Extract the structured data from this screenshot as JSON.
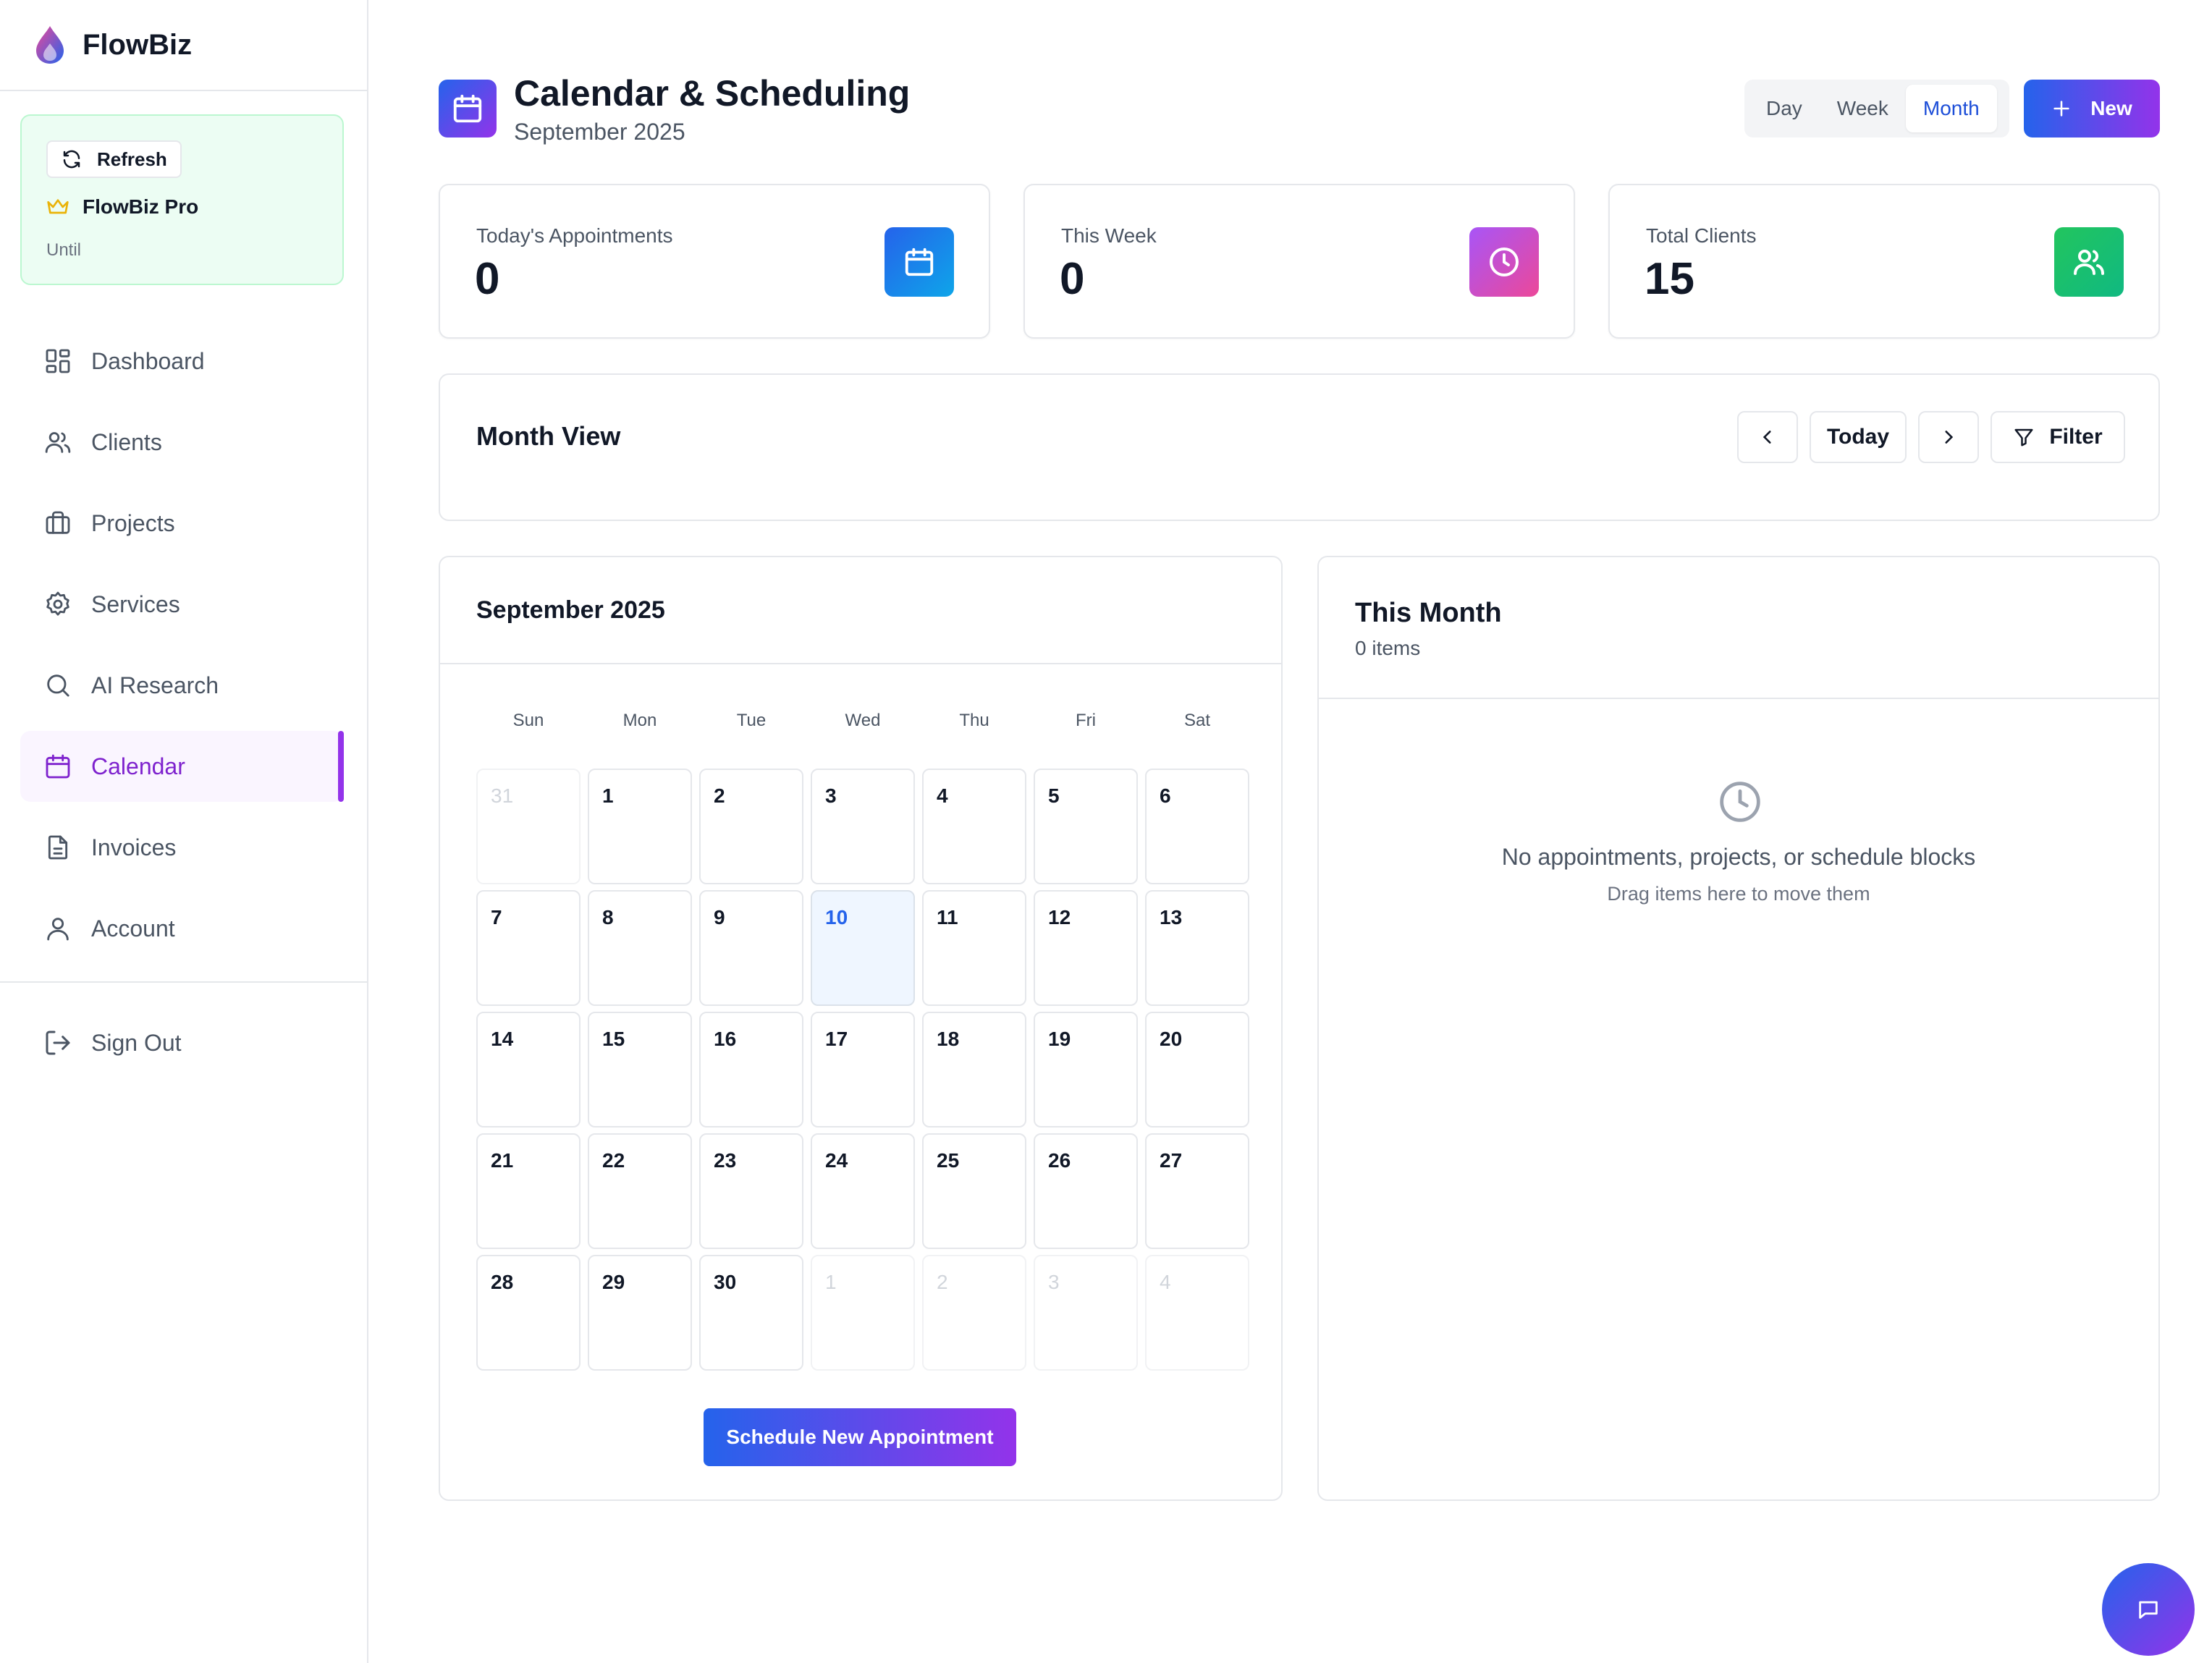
{
  "brand": {
    "name": "FlowBiz"
  },
  "plan": {
    "refresh_label": "Refresh",
    "name": "FlowBiz Pro",
    "until_label": "Until"
  },
  "nav": {
    "items": [
      {
        "label": "Dashboard",
        "icon": "dashboard-icon"
      },
      {
        "label": "Clients",
        "icon": "users-icon"
      },
      {
        "label": "Projects",
        "icon": "briefcase-icon"
      },
      {
        "label": "Services",
        "icon": "gear-icon"
      },
      {
        "label": "AI Research",
        "icon": "search-icon"
      },
      {
        "label": "Calendar",
        "icon": "calendar-icon",
        "active": true
      },
      {
        "label": "Invoices",
        "icon": "document-icon"
      },
      {
        "label": "Account",
        "icon": "user-icon"
      }
    ],
    "sign_out": "Sign Out"
  },
  "header": {
    "title": "Calendar & Scheduling",
    "subtitle": "September 2025",
    "view_tabs": [
      "Day",
      "Week",
      "Month"
    ],
    "active_view": "Month",
    "new_label": "New"
  },
  "stats": [
    {
      "label": "Today's Appointments",
      "value": "0",
      "icon": "calendar-icon",
      "color": "#0284c7"
    },
    {
      "label": "This Week",
      "value": "0",
      "icon": "clock-icon",
      "color": "#c026d3"
    },
    {
      "label": "Total Clients",
      "value": "15",
      "icon": "users-icon",
      "color": "#16a34a"
    }
  ],
  "month_view": {
    "title": "Month View",
    "today_label": "Today",
    "filter_label": "Filter"
  },
  "calendar": {
    "title": "September 2025",
    "weekdays": [
      "Sun",
      "Mon",
      "Tue",
      "Wed",
      "Thu",
      "Fri",
      "Sat"
    ],
    "days": [
      {
        "n": "31",
        "other": true
      },
      {
        "n": "1"
      },
      {
        "n": "2"
      },
      {
        "n": "3"
      },
      {
        "n": "4"
      },
      {
        "n": "5"
      },
      {
        "n": "6"
      },
      {
        "n": "7"
      },
      {
        "n": "8"
      },
      {
        "n": "9"
      },
      {
        "n": "10",
        "today": true
      },
      {
        "n": "11"
      },
      {
        "n": "12"
      },
      {
        "n": "13"
      },
      {
        "n": "14"
      },
      {
        "n": "15"
      },
      {
        "n": "16"
      },
      {
        "n": "17"
      },
      {
        "n": "18"
      },
      {
        "n": "19"
      },
      {
        "n": "20"
      },
      {
        "n": "21"
      },
      {
        "n": "22"
      },
      {
        "n": "23"
      },
      {
        "n": "24"
      },
      {
        "n": "25"
      },
      {
        "n": "26"
      },
      {
        "n": "27"
      },
      {
        "n": "28"
      },
      {
        "n": "29"
      },
      {
        "n": "30"
      },
      {
        "n": "1",
        "other": true
      },
      {
        "n": "2",
        "other": true
      },
      {
        "n": "3",
        "other": true
      },
      {
        "n": "4",
        "other": true
      }
    ],
    "schedule_label": "Schedule New Appointment"
  },
  "this_month": {
    "title": "This Month",
    "count_label": "0 items",
    "empty_title": "No appointments, projects, or schedule blocks",
    "empty_sub": "Drag items here to move them"
  },
  "colors": {
    "accent_blue": "#2563eb",
    "accent_purple": "#9333ea",
    "active_nav": "#7e22ce"
  }
}
